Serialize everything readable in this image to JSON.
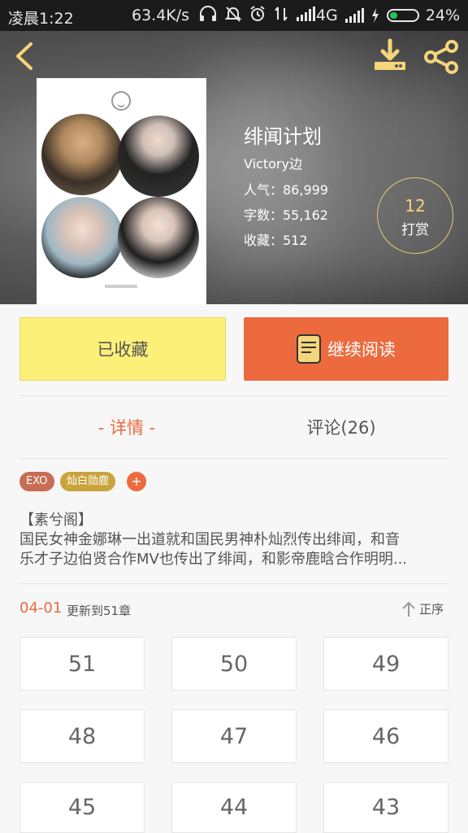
{
  "status_bar": {
    "time": "凌晨1:22",
    "net_speed": "63.4K/s",
    "network": "4G",
    "battery": "24%",
    "battery_level": 0.24,
    "icons": [
      "headphones-icon",
      "mute-icon",
      "alarm-icon",
      "data-transfer-icon",
      "signal-icon",
      "signal-icon",
      "charging-icon",
      "battery-icon"
    ]
  },
  "header": {
    "back_icon": "chevron-left-icon",
    "download_icon": "download-icon",
    "share_icon": "share-icon",
    "accent": "#f5d57a"
  },
  "book": {
    "title": "绯闻计划",
    "author": "Victory边",
    "popularity": "人气：86,999",
    "word_count": "字数：55,162",
    "favorites": "收藏：512"
  },
  "reward": {
    "count": "12",
    "label": "打赏"
  },
  "actions": {
    "favorite_label": "已收藏",
    "read_label": "继续阅读",
    "fav_color": "#fdf079",
    "read_color": "#ec6a3e"
  },
  "tabs": {
    "detail": "- 详情 -",
    "comments": "评论(26)"
  },
  "tags": [
    "EXO",
    "灿白勋鹿",
    "+"
  ],
  "description": {
    "line1": "【素兮阁】",
    "line2": "国民女神金娜琳一出道就和国民男神朴灿烈传出绯闻，和音",
    "line3": "乐才子边伯贤合作MV也传出了绯闻，和影帝鹿晗合作明明..."
  },
  "update": {
    "date": "04-01",
    "text": "更新到51章",
    "sort_label": "正序"
  },
  "chapters": [
    "51",
    "50",
    "49",
    "48",
    "47",
    "46",
    "45",
    "44",
    "43"
  ]
}
